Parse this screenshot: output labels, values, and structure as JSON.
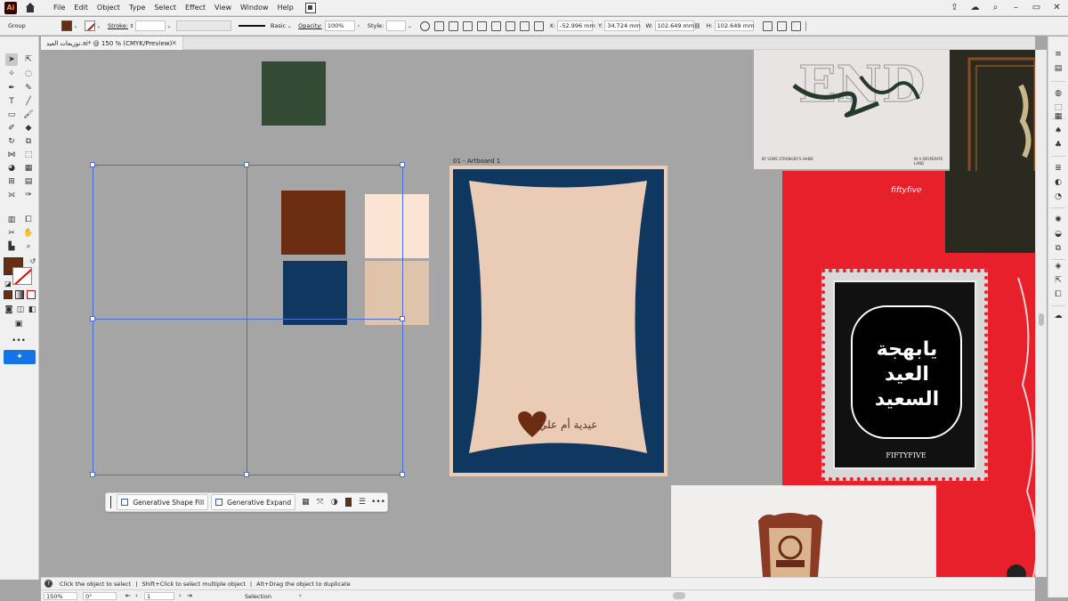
{
  "app": {
    "logo": "Ai",
    "menus": [
      "File",
      "Edit",
      "Object",
      "Type",
      "Select",
      "Effect",
      "View",
      "Window",
      "Help"
    ]
  },
  "controlbar": {
    "selection_type": "Group",
    "stroke_label": "Stroke:",
    "brush_value": "Basic",
    "opacity_label": "Opacity:",
    "opacity_value": "100%",
    "style_label": "Style:",
    "x_label": "X:",
    "x_value": "-52.996 mm",
    "y_label": "Y:",
    "y_value": "34.724 mm",
    "w_label": "W:",
    "w_value": "102.649 mm",
    "h_label": "H:",
    "h_value": "102.649 mm",
    "fill_color": "#6b2d12"
  },
  "document": {
    "tab_title": "توزيعات العيد.ai* @ 150 % (CMYK/Preview)",
    "artboard_label": "01 - Artboard 1"
  },
  "canvas": {
    "swatches": {
      "dark_green": "#334b35",
      "brown": "#6b2d12",
      "navy": "#10375f",
      "light_peach": "#fbe4d3",
      "beige": "#e0c3ab"
    },
    "poster": {
      "bg_color": "#10375f",
      "panel_color": "#eacbb5",
      "heart_color": "#6b2d12",
      "greeting_text": "عيدية أم علي"
    },
    "reference_images": {
      "stamp_text": "يابهجة العيد السعيد",
      "stamp_brand": "FIFTYFIVE",
      "red_brand": "fiftyfive",
      "book_footer_left": "BY SOME STRANGER'S HAND",
      "book_footer_right": "IN A DESPERATE LAND",
      "red_color": "#e8202b"
    }
  },
  "contextual_bar": {
    "generative_shape_fill": "Generative Shape Fill",
    "generative_expand": "Generative Expand"
  },
  "status": {
    "hint_1": "Click the object to select",
    "hint_2": "Shift+Click to select multiple object",
    "hint_3": "Alt+Drag the object to duplicate",
    "zoom": "150%",
    "rotation": "0°",
    "artboard_index": "1",
    "mode": "Selection"
  }
}
